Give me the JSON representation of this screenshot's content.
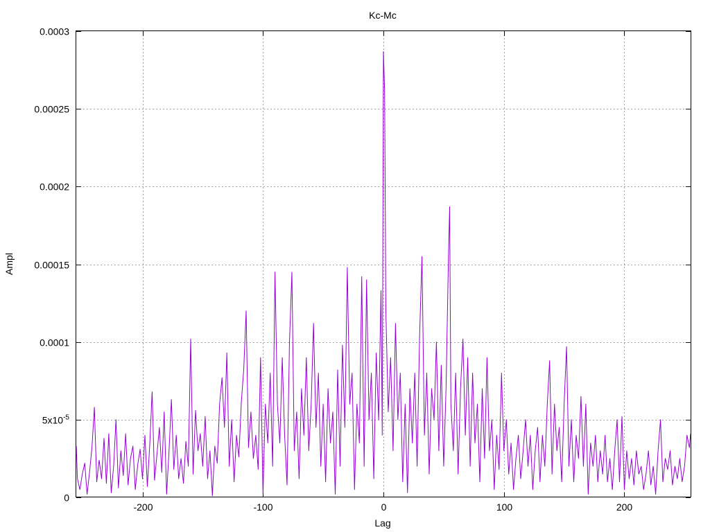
{
  "chart_data": {
    "type": "line",
    "title": "Kc-Mc",
    "xlabel": "Lag",
    "ylabel": "Ampl",
    "xlim": [
      -255,
      255
    ],
    "ylim": [
      0,
      0.0003
    ],
    "grid": true,
    "x_ticks": [
      -200,
      -100,
      0,
      100,
      200
    ],
    "x_tick_labels": [
      "-200",
      "-100",
      "0",
      "100",
      "200"
    ],
    "y_ticks": [
      0,
      5e-05,
      0.0001,
      0.00015,
      0.0002,
      0.00025,
      0.0003
    ],
    "y_tick_labels": [
      "0",
      "5x10-5",
      "0.0001",
      "0.00015",
      "0.0002",
      "0.00025",
      "0.0003"
    ],
    "series": [
      {
        "color": "#9400d3",
        "points": [
          [
            -255,
            3.3e-05
          ],
          [
            -254,
            1.2e-05
          ],
          [
            -252,
            5e-06
          ],
          [
            -250,
            1.5e-05
          ],
          [
            -248,
            2.2e-05
          ],
          [
            -246,
            2e-06
          ],
          [
            -244,
            1.6e-05
          ],
          [
            -242,
            3.2e-05
          ],
          [
            -240,
            5.8e-05
          ],
          [
            -238,
            1e-05
          ],
          [
            -236,
            2.4e-05
          ],
          [
            -234,
            1.2e-05
          ],
          [
            -232,
            3.8e-05
          ],
          [
            -230,
            9e-06
          ],
          [
            -228,
            4.1e-05
          ],
          [
            -226,
            3e-06
          ],
          [
            -224,
            2e-05
          ],
          [
            -222,
            5e-05
          ],
          [
            -220,
            6e-06
          ],
          [
            -218,
            3e-05
          ],
          [
            -216,
            1.4e-05
          ],
          [
            -214,
            4.1e-05
          ],
          [
            -212,
            8e-06
          ],
          [
            -210,
            2.5e-05
          ],
          [
            -208,
            3.3e-05
          ],
          [
            -206,
            5e-06
          ],
          [
            -204,
            2.1e-05
          ],
          [
            -202,
            3.1e-05
          ],
          [
            -200,
            1.2e-05
          ],
          [
            -198,
            4e-05
          ],
          [
            -196,
            7e-06
          ],
          [
            -194,
            3.4e-05
          ],
          [
            -192,
            6.8e-05
          ],
          [
            -190,
            1.1e-05
          ],
          [
            -188,
            2.8e-05
          ],
          [
            -186,
            4.5e-05
          ],
          [
            -184,
            1.6e-05
          ],
          [
            -182,
            5.5e-05
          ],
          [
            -180,
            2e-06
          ],
          [
            -178,
            3e-05
          ],
          [
            -176,
            6.3e-05
          ],
          [
            -174,
            1.8e-05
          ],
          [
            -172,
            4e-05
          ],
          [
            -170,
            1.2e-05
          ],
          [
            -168,
            2.5e-05
          ],
          [
            -166,
            9e-06
          ],
          [
            -164,
            3.6e-05
          ],
          [
            -162,
            2e-05
          ],
          [
            -160,
            0.000102
          ],
          [
            -158,
            1.5e-05
          ],
          [
            -156,
            5.6e-05
          ],
          [
            -154,
            3e-05
          ],
          [
            -152,
            4.1e-05
          ],
          [
            -150,
            2e-05
          ],
          [
            -148,
            5.2e-05
          ],
          [
            -146,
            1.2e-05
          ],
          [
            -144,
            3e-05
          ],
          [
            -142,
            1e-06
          ],
          [
            -140,
            3.3e-05
          ],
          [
            -138,
            2.2e-05
          ],
          [
            -136,
            6e-05
          ],
          [
            -134,
            7.7e-05
          ],
          [
            -132,
            4.5e-05
          ],
          [
            -130,
            9.3e-05
          ],
          [
            -128,
            2e-05
          ],
          [
            -126,
            5e-05
          ],
          [
            -124,
            1e-05
          ],
          [
            -122,
            4e-05
          ],
          [
            -120,
            2.6e-05
          ],
          [
            -118,
            6.1e-05
          ],
          [
            -116,
            8.2e-05
          ],
          [
            -114,
            0.00012
          ],
          [
            -112,
            3.2e-05
          ],
          [
            -110,
            5.5e-05
          ],
          [
            -108,
            2.5e-05
          ],
          [
            -106,
            4e-05
          ],
          [
            -104,
            1.8e-05
          ],
          [
            -102,
            9e-05
          ],
          [
            -100,
            2e-06
          ],
          [
            -98,
            6e-05
          ],
          [
            -96,
            3.5e-05
          ],
          [
            -94,
            8e-05
          ],
          [
            -92,
            2e-05
          ],
          [
            -90,
            0.000145
          ],
          [
            -88,
            6e-05
          ],
          [
            -86,
            3.5e-05
          ],
          [
            -84,
            9e-05
          ],
          [
            -82,
            4e-05
          ],
          [
            -80,
            8e-06
          ],
          [
            -78,
            0.0001
          ],
          [
            -76,
            0.000145
          ],
          [
            -74,
            3e-05
          ],
          [
            -72,
            5.5e-05
          ],
          [
            -70,
            1.2e-05
          ],
          [
            -68,
            7e-05
          ],
          [
            -66,
            4e-05
          ],
          [
            -64,
            9e-05
          ],
          [
            -62,
            3e-05
          ],
          [
            -60,
            6e-05
          ],
          [
            -58,
            0.000112
          ],
          [
            -56,
            4.5e-05
          ],
          [
            -54,
            8e-05
          ],
          [
            -52,
            2e-05
          ],
          [
            -50,
            6e-05
          ],
          [
            -48,
            1e-05
          ],
          [
            -46,
            7e-05
          ],
          [
            -44,
            3.5e-05
          ],
          [
            -42,
            5.5e-05
          ],
          [
            -40,
            2e-06
          ],
          [
            -38,
            8.2e-05
          ],
          [
            -36,
            2e-05
          ],
          [
            -34,
            9.8e-05
          ],
          [
            -32,
            4.5e-05
          ],
          [
            -30,
            0.000148
          ],
          [
            -28,
            6e-05
          ],
          [
            -26,
            8e-05
          ],
          [
            -24,
            5e-06
          ],
          [
            -22,
            6e-05
          ],
          [
            -20,
            3.5e-05
          ],
          [
            -18,
            0.000142
          ],
          [
            -16,
            2e-05
          ],
          [
            -14,
            0.00014
          ],
          [
            -12,
            5e-05
          ],
          [
            -10,
            8e-05
          ],
          [
            -8,
            1.2e-05
          ],
          [
            -6,
            9.3e-05
          ],
          [
            -4,
            5e-05
          ],
          [
            -2,
            0.000133
          ],
          [
            -1,
            4e-05
          ],
          [
            0,
            0.000287
          ],
          [
            1,
            0.000262
          ],
          [
            2,
            0.00012
          ],
          [
            4,
            5.5e-05
          ],
          [
            6,
            9e-05
          ],
          [
            8,
            3e-05
          ],
          [
            10,
            0.000112
          ],
          [
            12,
            5e-05
          ],
          [
            14,
            8e-05
          ],
          [
            16,
            1e-05
          ],
          [
            18,
            6e-05
          ],
          [
            20,
            3e-06
          ],
          [
            22,
            7e-05
          ],
          [
            24,
            3.5e-05
          ],
          [
            26,
            8e-05
          ],
          [
            28,
            2e-05
          ],
          [
            30,
            0.000103
          ],
          [
            32,
            0.000155
          ],
          [
            34,
            4e-05
          ],
          [
            36,
            8e-05
          ],
          [
            38,
            1.5e-05
          ],
          [
            40,
            7e-05
          ],
          [
            42,
            5e-05
          ],
          [
            44,
            0.0001
          ],
          [
            46,
            3e-05
          ],
          [
            48,
            8.5e-05
          ],
          [
            50,
            2e-05
          ],
          [
            52,
            7e-05
          ],
          [
            54,
            0.000155
          ],
          [
            55,
            0.000187
          ],
          [
            56,
            6e-05
          ],
          [
            58,
            3e-05
          ],
          [
            60,
            8e-05
          ],
          [
            62,
            1.5e-05
          ],
          [
            64,
            7e-05
          ],
          [
            66,
            0.000102
          ],
          [
            68,
            4e-05
          ],
          [
            70,
            9e-05
          ],
          [
            72,
            2e-05
          ],
          [
            74,
            8e-05
          ],
          [
            76,
            3.5e-05
          ],
          [
            78,
            6e-05
          ],
          [
            80,
            1e-05
          ],
          [
            82,
            7e-05
          ],
          [
            84,
            2.5e-05
          ],
          [
            86,
            9e-05
          ],
          [
            88,
            3e-05
          ],
          [
            90,
            5e-05
          ],
          [
            92,
            5e-06
          ],
          [
            94,
            4e-05
          ],
          [
            96,
            1.8e-05
          ],
          [
            98,
            8e-05
          ],
          [
            100,
            3e-05
          ],
          [
            102,
            5e-05
          ],
          [
            104,
            1.5e-05
          ],
          [
            106,
            3.5e-05
          ],
          [
            108,
            5e-06
          ],
          [
            110,
            2.5e-05
          ],
          [
            112,
            4e-05
          ],
          [
            114,
            1.2e-05
          ],
          [
            116,
            3e-05
          ],
          [
            118,
            5e-05
          ],
          [
            120,
            2e-05
          ],
          [
            122,
            4e-05
          ],
          [
            124,
            5e-06
          ],
          [
            126,
            3e-05
          ],
          [
            128,
            4.5e-05
          ],
          [
            130,
            1e-05
          ],
          [
            132,
            4e-05
          ],
          [
            134,
            2e-05
          ],
          [
            136,
            6e-05
          ],
          [
            138,
            8.8e-05
          ],
          [
            140,
            1.5e-05
          ],
          [
            142,
            6e-05
          ],
          [
            144,
            3e-05
          ],
          [
            146,
            4.5e-05
          ],
          [
            148,
            1e-05
          ],
          [
            150,
            6e-05
          ],
          [
            152,
            9.7e-05
          ],
          [
            154,
            2e-05
          ],
          [
            156,
            5e-05
          ],
          [
            158,
            1e-05
          ],
          [
            160,
            4e-05
          ],
          [
            162,
            2.5e-05
          ],
          [
            164,
            6.5e-05
          ],
          [
            166,
            2e-05
          ],
          [
            168,
            6e-05
          ],
          [
            170,
            2e-06
          ],
          [
            172,
            3.5e-05
          ],
          [
            174,
            2e-05
          ],
          [
            176,
            4e-05
          ],
          [
            178,
            1e-05
          ],
          [
            180,
            3e-05
          ],
          [
            182,
            1.5e-05
          ],
          [
            184,
            4e-05
          ],
          [
            186,
            1e-05
          ],
          [
            188,
            2.5e-05
          ],
          [
            190,
            5e-06
          ],
          [
            192,
            3e-05
          ],
          [
            194,
            5e-05
          ],
          [
            196,
            1e-05
          ],
          [
            198,
            5.2e-05
          ],
          [
            200,
            5e-06
          ],
          [
            202,
            3e-05
          ],
          [
            204,
            1.2e-05
          ],
          [
            206,
            2.5e-05
          ],
          [
            208,
            8e-06
          ],
          [
            210,
            3e-05
          ],
          [
            212,
            1.5e-05
          ],
          [
            214,
            2e-05
          ],
          [
            216,
            5e-06
          ],
          [
            218,
            1.5e-05
          ],
          [
            220,
            3e-05
          ],
          [
            222,
            8e-06
          ],
          [
            224,
            2e-05
          ],
          [
            226,
            2e-06
          ],
          [
            228,
            3e-05
          ],
          [
            230,
            5e-05
          ],
          [
            232,
            1e-05
          ],
          [
            234,
            2.5e-05
          ],
          [
            236,
            1.8e-05
          ],
          [
            238,
            3e-05
          ],
          [
            240,
            8e-06
          ],
          [
            242,
            2e-05
          ],
          [
            244,
            1.2e-05
          ],
          [
            246,
            2.5e-05
          ],
          [
            248,
            1e-05
          ],
          [
            250,
            2e-05
          ],
          [
            252,
            4e-05
          ],
          [
            254,
            3.2e-05
          ],
          [
            255,
            4.1e-05
          ]
        ]
      }
    ]
  }
}
